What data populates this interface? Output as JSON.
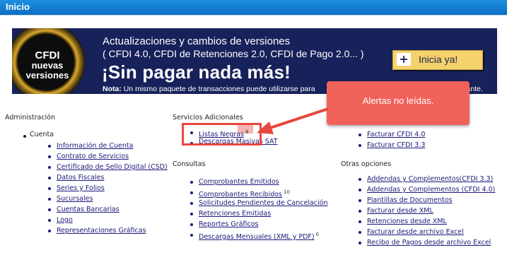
{
  "header": {
    "title": "Inicio"
  },
  "banner": {
    "badge_line1": "CFDI",
    "badge_line2": "nuevas",
    "badge_line3": "versiones",
    "line1": "Actualizaciones y cambios de versiones",
    "line2": "( CFDI 4.0, CFDI de Retenciones 2.0, CFDI de Pago 2.0... )",
    "headline": "¡Sin pagar nada más!",
    "note_label": "Nota:",
    "note_text": "Un mismo paquete de transacciones puede utilizarse para",
    "note_tail": "pante.",
    "cta_icon": "+",
    "cta_label": "Inicia ya!"
  },
  "callout": {
    "text": "Alertas no leídas."
  },
  "administracion": {
    "title": "Administración",
    "group": "Cuenta",
    "items": [
      "Información de Cuenta",
      "Contrato de Servicios",
      "Certificado de Sello Digital (CSD)",
      "Datos Fiscales",
      "Series y Folios",
      "Sucursales",
      "Cuentas Bancarias",
      "Logo",
      "Representaciones Gráficas"
    ]
  },
  "servicios": {
    "title": "Servicios Adicionales",
    "items": [
      {
        "label": "Listas Negras",
        "count": "8"
      },
      {
        "label": "Descargas Masivas SAT",
        "count": ""
      }
    ]
  },
  "consultas": {
    "title": "Consultas",
    "items": [
      {
        "label": "Comprobantes Emitidos",
        "count": ""
      },
      {
        "label": "Comprobantes Recibidos",
        "count": "10"
      },
      {
        "label": "Solicitudes Pendientes de Cancelación",
        "count": ""
      },
      {
        "label": "Retenciones Emitidas",
        "count": ""
      },
      {
        "label": "Reportes Gráficos",
        "count": ""
      },
      {
        "label": "Descargas Mensuales (XML y PDF)",
        "count": "0"
      }
    ]
  },
  "facturar": {
    "items": [
      "Facturar CFDI 4.0",
      "Facturar CFDI 3.3"
    ]
  },
  "otras": {
    "title": "Otras opciones",
    "items": [
      "Addendas y Complementos(CFDI 3.3)",
      "Addendas y Complementos (CFDI 4.0)",
      "Plantillas de Documentos",
      "Facturar desde XML",
      "Retenciones desde XML",
      "Facturar desde archivo Excel",
      "Recibo de Pagos desde archivo Excel"
    ]
  },
  "colors": {
    "header": "#0b6fc2",
    "banner": "#17215a",
    "callout": "#f0625a",
    "link": "#1a1a7a",
    "cta": "#f5d26c"
  }
}
